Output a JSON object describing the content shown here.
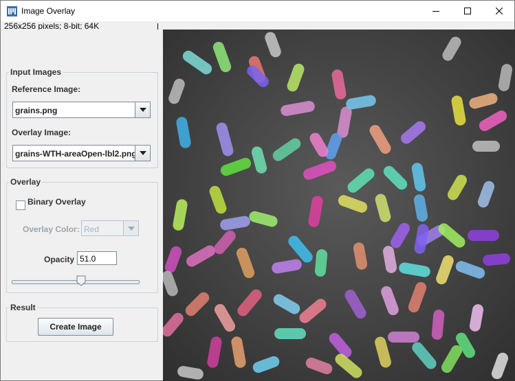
{
  "window": {
    "title": "Image Overlay",
    "info_line": "256x256 pixels; 8-bit; 64K",
    "controls": {
      "minimize": "minimize",
      "maximize": "maximize",
      "close": "close"
    }
  },
  "input_images": {
    "title": "Input Images",
    "reference_label": "Reference Image:",
    "reference_value": "grains.png",
    "overlay_label": "Overlay Image:",
    "overlay_value": "grains-WTH-areaOpen-lbl2.png"
  },
  "overlay": {
    "title": "Overlay",
    "binary_overlay_label": "Binary Overlay",
    "binary_overlay_checked": false,
    "color_label": "Overlay Color:",
    "color_value": "Red",
    "opacity_label": "Opacity",
    "opacity_value": "51.0",
    "opacity_slider_fraction": 0.51
  },
  "result": {
    "title": "Result",
    "create_button": "Create Image"
  },
  "canvas": {
    "background": "#3c3c3c"
  }
}
